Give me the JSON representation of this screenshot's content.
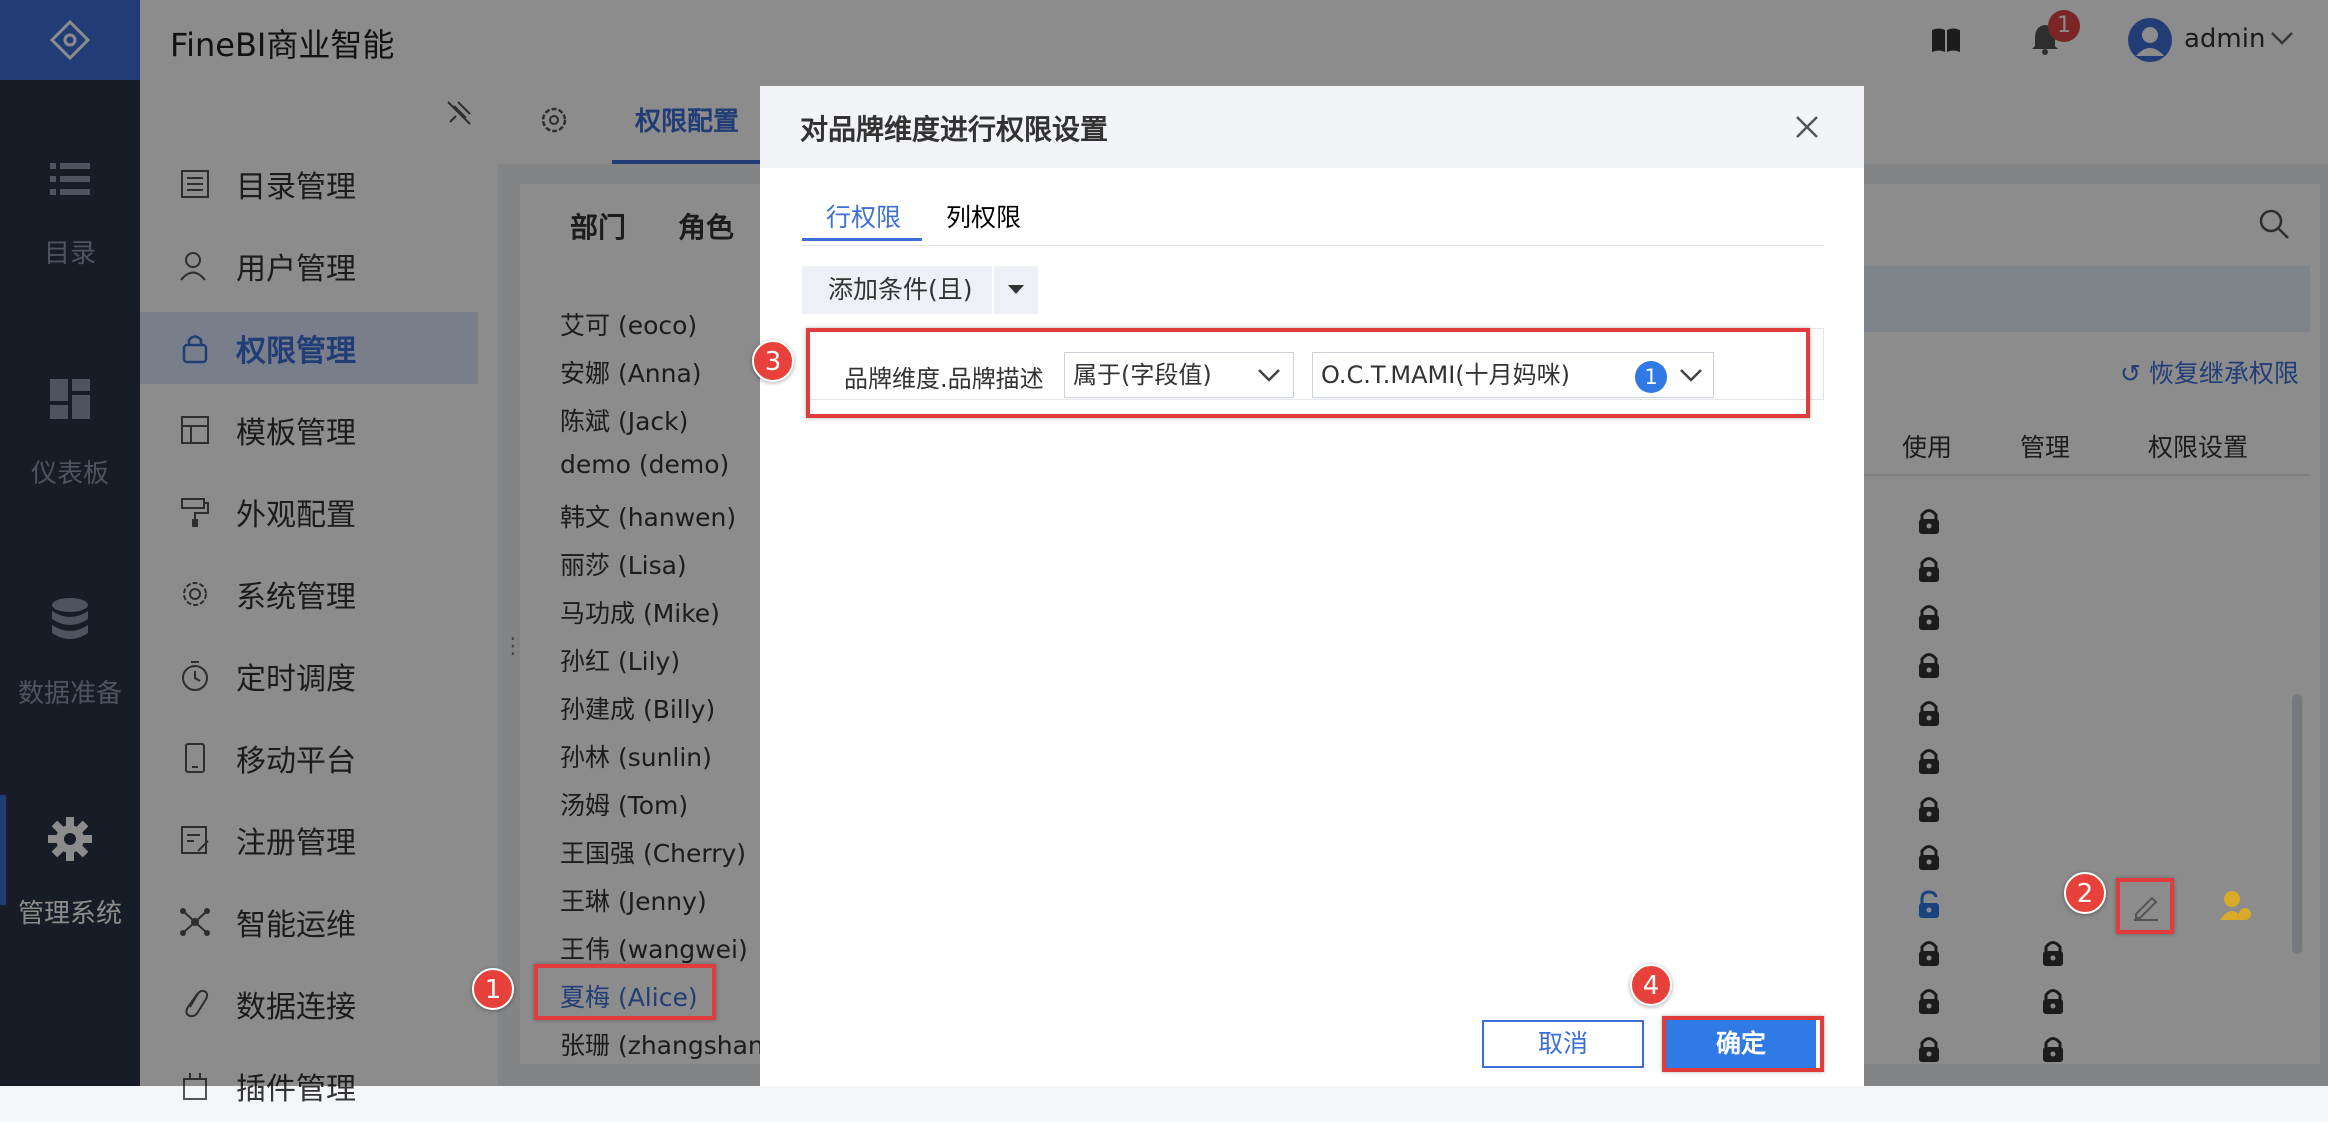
{
  "header": {
    "brand": "FineBI商业智能",
    "notification_count": "1",
    "username": "admin"
  },
  "rail": {
    "items": [
      {
        "label": "目录",
        "icon": "list-icon"
      },
      {
        "label": "仪表板",
        "icon": "dashboard-icon"
      },
      {
        "label": "数据准备",
        "icon": "database-icon"
      },
      {
        "label": "管理系统",
        "icon": "gear-icon",
        "active": true
      }
    ]
  },
  "sidebar": {
    "items": [
      {
        "label": "目录管理"
      },
      {
        "label": "用户管理"
      },
      {
        "label": "权限管理",
        "active": true
      },
      {
        "label": "模板管理"
      },
      {
        "label": "外观配置"
      },
      {
        "label": "系统管理"
      },
      {
        "label": "定时调度"
      },
      {
        "label": "移动平台"
      },
      {
        "label": "注册管理"
      },
      {
        "label": "智能运维"
      },
      {
        "label": "数据连接"
      },
      {
        "label": "插件管理"
      }
    ]
  },
  "main": {
    "tab": "权限配置",
    "sub_tabs": [
      "部门",
      "角色"
    ],
    "restore_label": "恢复继承权限",
    "columns": [
      "使用",
      "管理",
      "权限设置"
    ],
    "users": [
      "艾可 (eoco)",
      "安娜 (Anna)",
      "陈斌 (Jack)",
      "demo (demo)",
      "韩文 (hanwen)",
      "丽莎 (Lisa)",
      "马功成 (Mike)",
      "孙红 (Lily)",
      "孙建成 (Billy)",
      "孙林 (sunlin)",
      "汤姆 (Tom)",
      "王国强 (Cherry)",
      "王琳 (Jenny)",
      "王伟 (wangwei)",
      "夏梅 (Alice)",
      "张珊 (zhangshan)"
    ],
    "selected_user": "夏梅 (Alice)"
  },
  "modal": {
    "title": "对品牌维度进行权限设置",
    "tabs": [
      "行权限",
      "列权限"
    ],
    "add_condition": "添加条件(且)",
    "condition": {
      "field": "品牌维度.品牌描述",
      "operator": "属于(字段值)",
      "value": "O.C.T.MAMI(十月妈咪)",
      "value_count": "1"
    },
    "cancel": "取消",
    "confirm": "确定"
  },
  "annotations": [
    "1",
    "2",
    "3",
    "4"
  ],
  "colors": {
    "accent": "#3e6fd8",
    "rail_bg": "#2b3445",
    "annotation": "#e03c3c"
  }
}
